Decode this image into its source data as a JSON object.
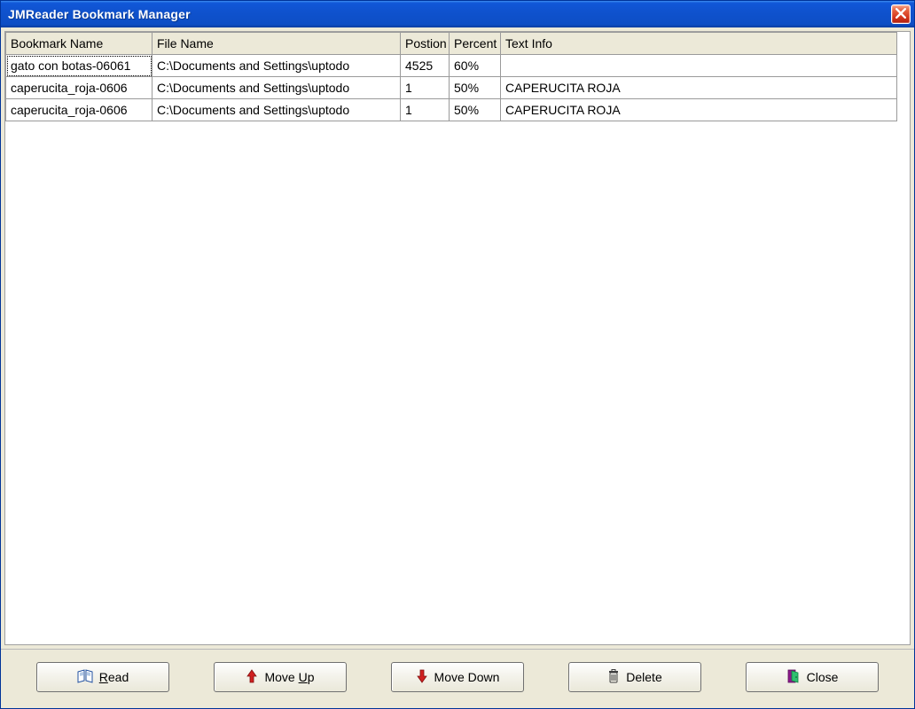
{
  "window": {
    "title": "JMReader Bookmark Manager"
  },
  "columns": {
    "bookmark": "Bookmark Name",
    "file": "File Name",
    "position": "Postion",
    "percent": "Percent",
    "textinfo": "Text Info"
  },
  "rows": [
    {
      "bookmark": "gato con botas-06061",
      "file": "C:\\Documents and Settings\\uptodo",
      "position": "4525",
      "percent": "60%",
      "textinfo": ""
    },
    {
      "bookmark": "caperucita_roja-0606",
      "file": "C:\\Documents and Settings\\uptodo",
      "position": "1",
      "percent": "50%",
      "textinfo": "CAPERUCITA ROJA"
    },
    {
      "bookmark": "caperucita_roja-0606",
      "file": "C:\\Documents and Settings\\uptodo",
      "position": "1",
      "percent": "50%",
      "textinfo": "CAPERUCITA ROJA"
    }
  ],
  "buttons": {
    "read_full": "Read",
    "read_u": "R",
    "read_rest": "ead",
    "moveup_full": "Move Up",
    "moveup_u": "U",
    "moveup_pre": "Move ",
    "moveup_post": "p",
    "movedown": "Move Down",
    "delete": "Delete",
    "close": "Close"
  }
}
